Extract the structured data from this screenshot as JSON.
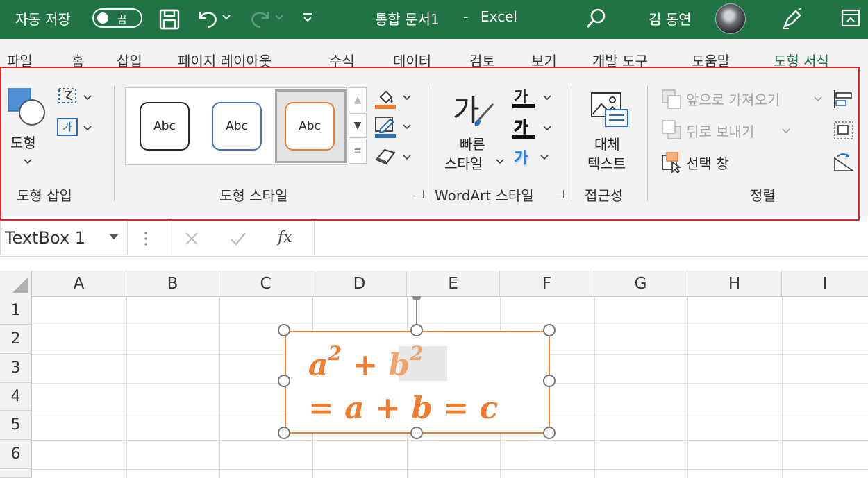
{
  "titlebar": {
    "autosave_label": "자동 저장",
    "autosave_state": "끔",
    "document": "통합 문서1",
    "separator": "-",
    "app": "Excel",
    "user": "김 동연"
  },
  "tabs": [
    "파일",
    "홈",
    "삽입",
    "페이지 레이아웃",
    "수식",
    "데이터",
    "검토",
    "보기",
    "개발 도구",
    "도움말",
    "도형 서식"
  ],
  "ribbon": {
    "insert_shapes": {
      "shape_label": "도형",
      "textbox_glyph": "가",
      "group_label": "도형 삽입"
    },
    "shape_styles": {
      "samples": [
        "Abc",
        "Abc",
        "Abc"
      ],
      "group_label": "도형 스타일"
    },
    "wordart": {
      "quick_style_glyph": "가",
      "quick_style_line1": "빠른",
      "quick_style_line2": "스타일",
      "text_fill_glyph": "가",
      "text_outline_glyph": "가",
      "text_effects_glyph": "가",
      "group_label": "WordArt 스타일"
    },
    "accessibility": {
      "alt_text_line1": "대체",
      "alt_text_line2": "텍스트",
      "group_label": "접근성"
    },
    "arrange": {
      "bring_forward": "앞으로 가져오기",
      "send_backward": "뒤로 보내기",
      "selection_pane": "선택 창",
      "group_label": "정렬"
    }
  },
  "formula_bar": {
    "name_box": "TextBox 1",
    "fx": "fx"
  },
  "grid": {
    "columns": [
      "A",
      "B",
      "C",
      "D",
      "E",
      "F",
      "G",
      "H",
      "I"
    ],
    "rows": [
      "1",
      "2",
      "3",
      "4",
      "5",
      "6"
    ]
  },
  "textbox": {
    "line1_a": "a",
    "line1_exp1": "2",
    "line1_plus": "+",
    "line1_b": "b",
    "line1_exp2": "2",
    "line2": "= a + b = c"
  },
  "colors": {
    "excel_green": "#217346",
    "highlight_border": "#e0242b",
    "textbox_orange": "#ed7d31"
  }
}
